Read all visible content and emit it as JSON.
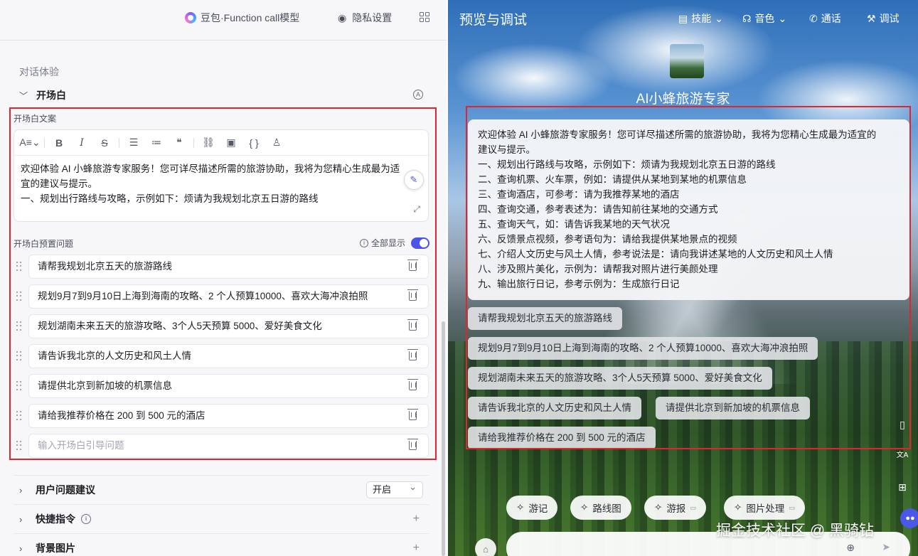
{
  "topbar": {
    "model_name": "豆包·Function call模型",
    "privacy_label": "隐私设置"
  },
  "editor_panel": {
    "section_title": "对话体验",
    "opener_label": "开场白",
    "opener_text_label": "开场白文案",
    "opener_text_line1": "欢迎体验 AI 小蜂旅游专家服务！您可详尽描述所需的旅游协助，我将为您精心生成最为适",
    "opener_text_line2": "宜的建议与提示。",
    "opener_text_line3": "一、规划出行路线与攻略，示例如下：烦请为我规划北京五日游的路线",
    "preset_label": "开场白预置问题",
    "show_all_label": "全部显示",
    "questions": [
      "请帮我规划北京五天的旅游路线",
      "规划9月7到9月10日上海到海南的攻略、2 个人预算10000、喜欢大海冲浪拍照",
      "规划湖南未来五天的旅游攻略、3个人5天预算 5000、爱好美食文化",
      "请告诉我北京的人文历史和风土人情",
      "请提供北京到新加坡的机票信息",
      "请给我推荐价格在 200 到 500 元的酒店"
    ],
    "question_placeholder": "输入开场白引导问题",
    "user_suggestion_label": "用户问题建议",
    "user_suggestion_value": "开启",
    "shortcut_label": "快捷指令",
    "background_label": "背景图片"
  },
  "preview": {
    "title": "预览与调试",
    "nav": {
      "skill": "技能",
      "voice": "音色",
      "call": "通话",
      "debug": "调试"
    },
    "agent_name": "AI小蜂旅游专家",
    "welcome_lines": [
      "欢迎体验 AI 小蜂旅游专家服务！您可详尽描述所需的旅游协助，我将为您精心生成最为适宜的",
      "建议与提示。",
      "一、规划出行路线与攻略，示例如下：烦请为我规划北京五日游的路线",
      "二、查询机票、火车票，例如：请提供从某地到某地的机票信息",
      "三、查询酒店，可参考：请为我推荐某地的酒店",
      "四、查询交通，参考表述为：请告知前往某地的交通方式",
      "五、查询天气，如：请告诉我某地的天气状况",
      "六、反馈景点视频，参考语句为：请给我提供某地景点的视频",
      "七、介绍人文历史与风土人情，参考说法是：请向我讲述某地的人文历史和风土人情",
      "八、涉及照片美化，示例为：请帮我对照片进行美颜处理",
      "九、输出旅行日记，参考示例为：生成旅行日记"
    ],
    "chips": [
      "请帮我规划北京五天的旅游路线",
      "规划9月7到9月10日上海到海南的攻略、2 个人预算10000、喜欢大海冲浪拍照",
      "规划湖南未来五天的旅游攻略、3个人5天预算 5000、爱好美食文化",
      "请告诉我北京的人文历史和风土人情",
      "请提供北京到新加坡的机票信息",
      "请给我推荐价格在 200 到 500 元的酒店"
    ],
    "skills": [
      "游记",
      "路线图",
      "游报",
      "图片处理"
    ],
    "watermark": "掘金技术社区 @ 黑骑钻"
  }
}
